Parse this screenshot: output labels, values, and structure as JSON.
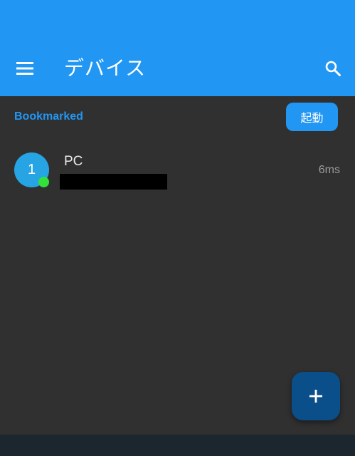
{
  "app_bar": {
    "title": "デバイス",
    "menu_icon": "menu-icon",
    "search_icon": "search-icon",
    "color": "#2196f3"
  },
  "section": {
    "label": "Bookmarked",
    "launch_button_label": "起動"
  },
  "devices": [
    {
      "avatar_text": "1",
      "name": "PC",
      "latency": "6ms",
      "status": "online",
      "status_color": "#34e03a"
    }
  ],
  "fab": {
    "icon": "plus-icon"
  }
}
